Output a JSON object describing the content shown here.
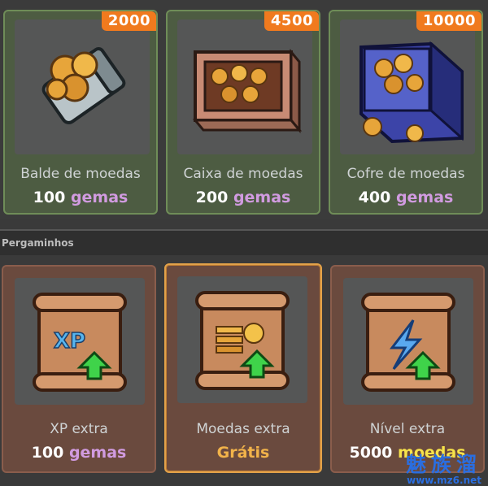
{
  "coin_items": [
    {
      "badge": "2000",
      "label": "Balde de moedas",
      "price_amount": "100",
      "price_unit": "gemas",
      "icon": "coin-bucket-icon"
    },
    {
      "badge": "4500",
      "label": "Caixa de moedas",
      "price_amount": "200",
      "price_unit": "gemas",
      "icon": "coin-crate-icon"
    },
    {
      "badge": "10000",
      "label": "Cofre de moedas",
      "price_amount": "400",
      "price_unit": "gemas",
      "icon": "coin-chest-icon"
    }
  ],
  "section": {
    "title": "Pergaminhos"
  },
  "scroll_items": [
    {
      "label": "XP extra",
      "price_amount": "100",
      "price_unit": "gemas",
      "icon": "xp-scroll-icon",
      "icon_text": "XP"
    },
    {
      "label": "Moedas extra",
      "price_text": "Grátis",
      "icon": "coins-scroll-icon"
    },
    {
      "label": "Nível extra",
      "price_amount": "5000",
      "price_unit": "moedas",
      "icon": "level-scroll-icon"
    }
  ],
  "watermark": {
    "chars": "魅族溜",
    "url": "www.mz6.net"
  },
  "colors": {
    "badge": "#f07a1e",
    "gem_unit": "#d19be0",
    "free": "#f2b34a",
    "card_green_border": "#6f8d58",
    "card_brown_border": "#8a5d4c",
    "card_selected_border": "#e2a24a"
  }
}
